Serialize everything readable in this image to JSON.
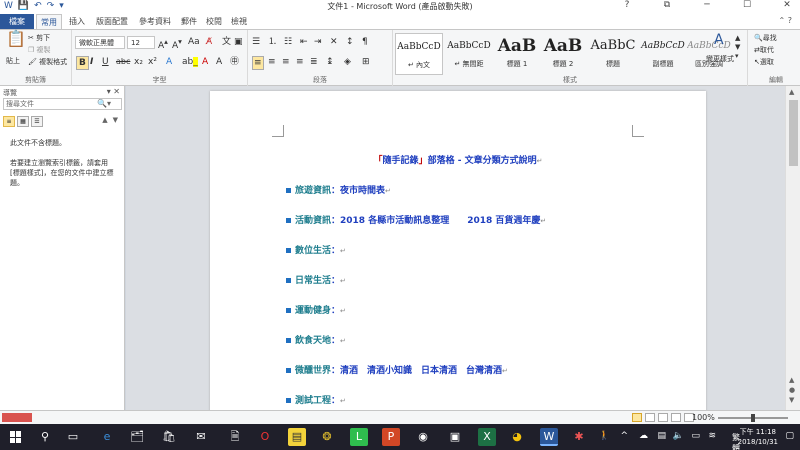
{
  "window": {
    "title": "文件1 - Microsoft Word (產品啟動失敗)",
    "controls": [
      "?",
      "⧉",
      "─",
      "☐",
      "✕"
    ]
  },
  "qat": {
    "icons": [
      "word-logo-icon",
      "save-icon",
      "undo-icon",
      "redo-icon",
      "customize-icon"
    ]
  },
  "tabs": {
    "file": "檔案",
    "items": [
      "常用",
      "插入",
      "版面配置",
      "參考資料",
      "郵件",
      "校閱",
      "檢視"
    ],
    "active": "常用"
  },
  "ribbon": {
    "clipboard": {
      "paste": "貼上",
      "cut": "剪下",
      "copy": "複製",
      "format_painter": "複製格式",
      "label": "剪貼簿"
    },
    "font": {
      "name": "微軟正黑體",
      "size": "12",
      "label": "字型"
    },
    "paragraph": {
      "label": "段落"
    },
    "styles": {
      "label": "樣式",
      "items": [
        {
          "preview": "AaBbCcD",
          "name": "↵ 內文"
        },
        {
          "preview": "AaBbCcD",
          "name": "↵ 無間距"
        },
        {
          "preview": "AaB",
          "name": "標題 1"
        },
        {
          "preview": "AaB",
          "name": "標題 2"
        },
        {
          "preview": "AaBbC",
          "name": "標題"
        },
        {
          "preview": "AaBbCcD",
          "name": "副標題"
        },
        {
          "preview": "AaBbCcD",
          "name": "區別強調"
        }
      ],
      "change_styles": "變更樣式"
    },
    "editing": {
      "find": "尋找",
      "replace": "取代",
      "select": "選取",
      "label": "編輯"
    }
  },
  "nav": {
    "title": "導覽",
    "search_placeholder": "搜尋文件",
    "no_headings": "此文件不含標題。",
    "instructions": "若要建立瀏覽索引標籤，請套用 [標題樣式]，在您的文件中建立標題。"
  },
  "document": {
    "title_open": "「",
    "title_main": "隨手記錄",
    "title_close": "」",
    "title_rest": "部落格 - 文章分類方式說明",
    "lines": [
      {
        "cat": "旅遊資訊",
        "val": "：夜市時間表"
      },
      {
        "cat": "活動資訊",
        "val": "：2018 各縣市活動訊息整理　　2018 百貨週年慶"
      },
      {
        "cat": "數位生活",
        "val": "："
      },
      {
        "cat": "日常生活",
        "val": "："
      },
      {
        "cat": "運動健身",
        "val": "："
      },
      {
        "cat": "飲食天地",
        "val": "："
      },
      {
        "cat": "微醺世界",
        "val": "：清酒　清酒小知識　日本清酒　台灣清酒"
      },
      {
        "cat": "測試工程",
        "val": "："
      }
    ],
    "para_mark": "↵"
  },
  "status": {
    "zoom": "100%"
  },
  "taskbar": {
    "icons": [
      "search-icon",
      "taskview-icon",
      "edge-icon",
      "explorer-icon",
      "store-icon",
      "mail-icon",
      "opera-icon",
      "sticky-icon",
      "winrar-icon",
      "line-icon",
      "powerpoint-icon",
      "media-icon",
      "excel-icon",
      "chrome-icon",
      "word-icon",
      "game-icon"
    ],
    "ime": "繁體",
    "time": "下午 11:18",
    "date": "2018/10/31"
  },
  "colors": {
    "accent": "#2b579a",
    "doc_title": "#1f3fbf",
    "doc_category": "#1f7e8e",
    "bullet": "#1f6fc1"
  }
}
